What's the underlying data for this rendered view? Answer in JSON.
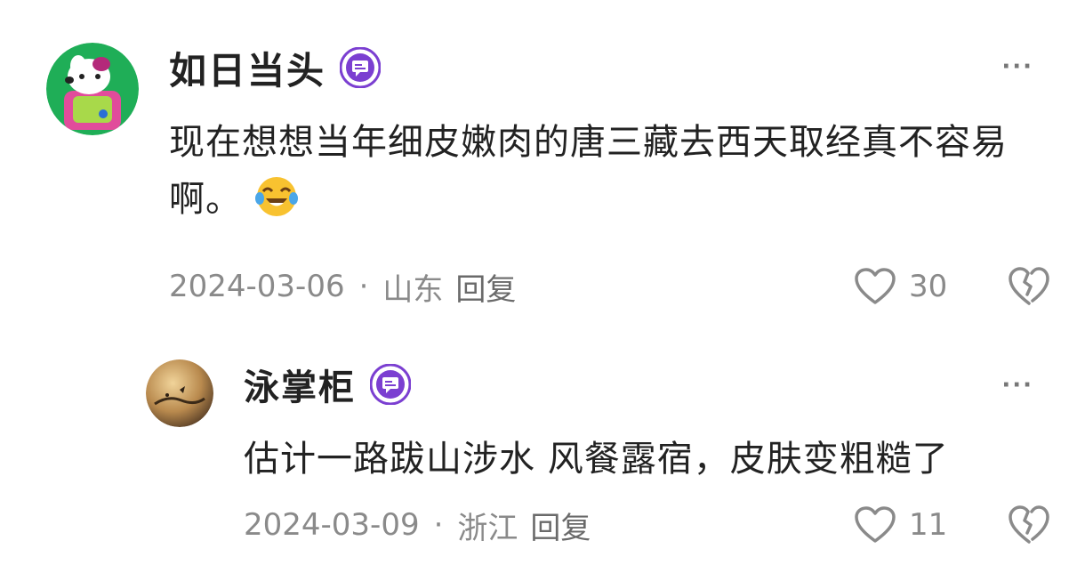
{
  "comments": [
    {
      "username": "如日当头",
      "text": "现在想想当年细皮嫩肉的唐三藏去西天取经真不容易啊。",
      "date": "2024-03-06",
      "location": "山东",
      "reply_label": "回复",
      "likes": "30",
      "more_label": "···",
      "badge_icon": "vip-chat-badge-icon",
      "emoji_icon": "laugh-cry-emoji-icon"
    },
    {
      "username": "泳掌柜",
      "text": "估计一路跋山涉水 风餐露宿，皮肤变粗糙了",
      "date": "2024-03-09",
      "location": "浙江",
      "reply_label": "回复",
      "likes": "11",
      "more_label": "···",
      "badge_icon": "vip-chat-badge-icon"
    }
  ],
  "separator": "·",
  "colors": {
    "badge_purple": "#7b3fd1",
    "meta_gray": "#8a8a8a",
    "text_dark": "#222222"
  }
}
